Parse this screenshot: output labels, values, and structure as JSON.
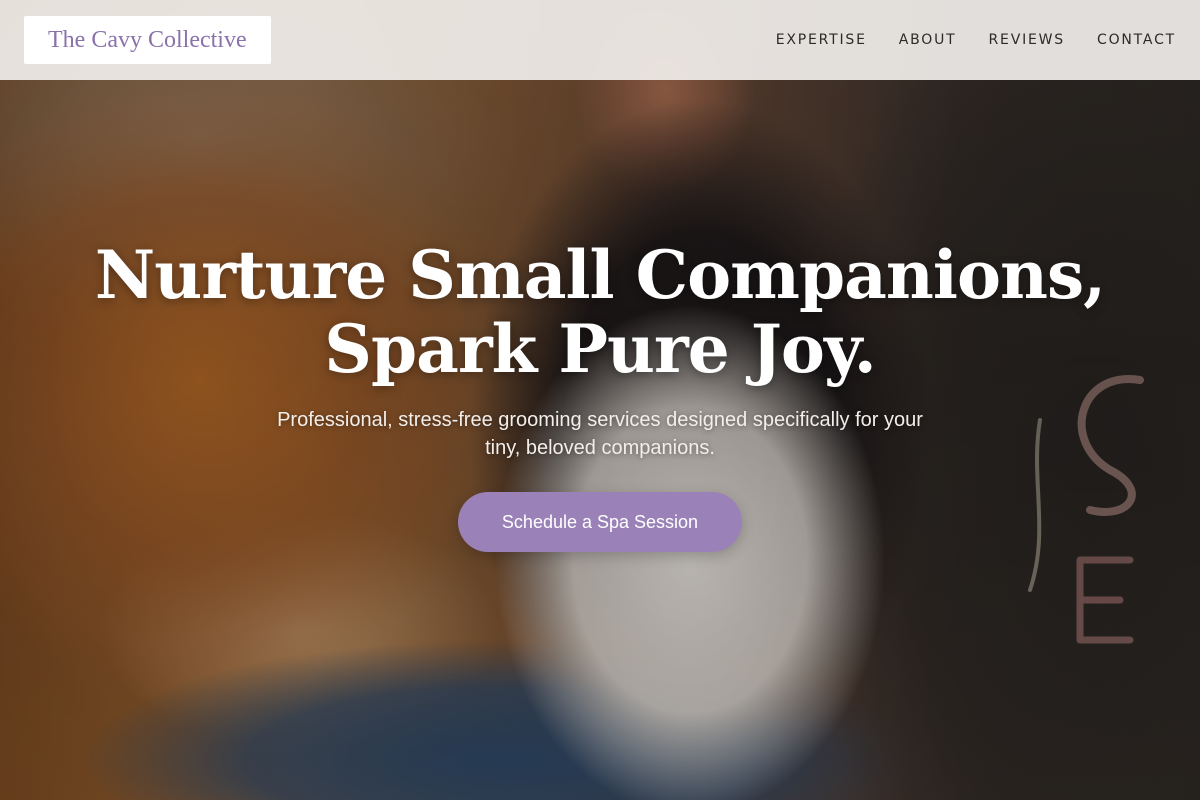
{
  "brand": {
    "name": "The Cavy Collective",
    "accent_color": "#9a82b8",
    "logo_text_color": "#8a72ab"
  },
  "nav": {
    "items": [
      {
        "label": "EXPERTISE"
      },
      {
        "label": "ABOUT"
      },
      {
        "label": "REVIEWS"
      },
      {
        "label": "CONTACT"
      }
    ]
  },
  "hero": {
    "title_line1": "Nurture Small Companions,",
    "title_line2": "Spark Pure Joy.",
    "subtitle": "Professional, stress-free grooming services designed specifically for your tiny, beloved companions.",
    "cta_label": "Schedule a Spa Session"
  }
}
